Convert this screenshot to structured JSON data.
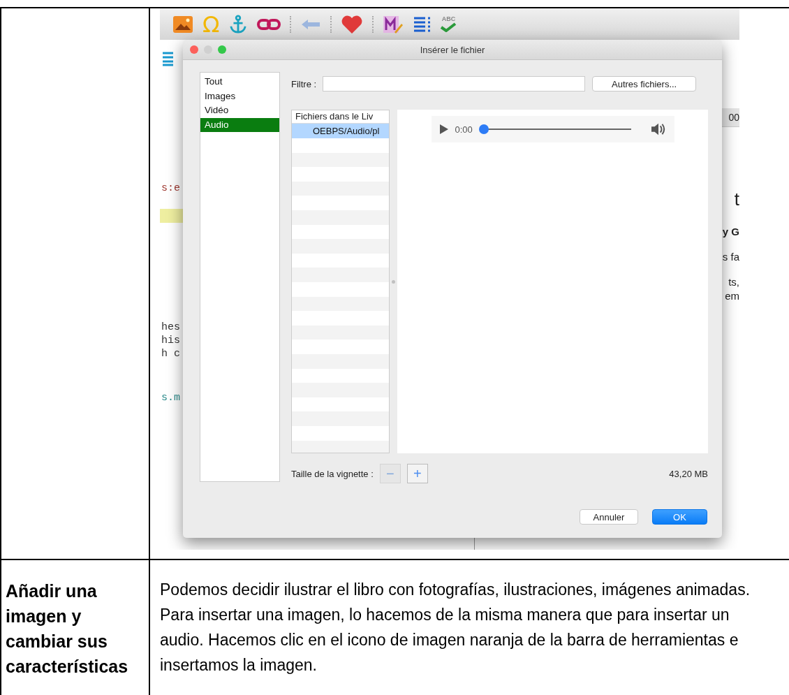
{
  "table": {
    "rows": [
      {
        "heading": "",
        "screenshot": {
          "toolbar": {
            "omega_glyph": "Ω",
            "spellcheck_label": "ABC"
          },
          "editor_fragments": [
            {
              "text": "s:e",
              "color": "#a03a32"
            },
            {
              "text": "hes",
              "color": "#333333"
            },
            {
              "text": "his",
              "color": "#333333"
            },
            {
              "text": "h c",
              "color": "#333333"
            },
            {
              "text": "s.m",
              "color": "#2a8a8a"
            }
          ],
          "preview_header": "00",
          "preview_fragments": [
            {
              "text": "t",
              "kind": "title"
            },
            {
              "text": "y G",
              "kind": "bold"
            },
            {
              "text": "s fa",
              "kind": "plain"
            },
            {
              "text": "ts,",
              "kind": "plain"
            },
            {
              "text": "em",
              "kind": "plain"
            }
          ],
          "dialog": {
            "title": "Insérer le fichier",
            "categories": [
              {
                "label": "Tout",
                "selected": false
              },
              {
                "label": "Images",
                "selected": false
              },
              {
                "label": "Vidéo",
                "selected": false
              },
              {
                "label": "Audio",
                "selected": true
              }
            ],
            "filter_label": "Filtre :",
            "other_files_button": "Autres fichiers...",
            "files_header": "Fichiers dans le Liv",
            "files": [
              {
                "name": "OEBPS/Audio/pl",
                "selected": true
              }
            ],
            "player": {
              "time": "0:00",
              "level": 0
            },
            "thumbnail_label": "Taille de la vignette :",
            "thumbnail_buttons": [
              {
                "label": "−",
                "disabled": true
              },
              {
                "label": "+",
                "disabled": false
              }
            ],
            "size": "43,20 MB",
            "buttons": [
              {
                "label": "Annuler",
                "kind": "secondary"
              },
              {
                "label": "OK",
                "kind": "primary"
              }
            ]
          }
        }
      },
      {
        "heading": "Añadir una imagen y cambiar sus características",
        "text": "Podemos decidir ilustrar el libro con fotografías, ilustraciones, imágenes animadas. Para insertar una imagen, lo hacemos de la misma manera que para insertar un audio. Hacemos clic en el icono de imagen naranja de la barra de herramientas e insertamos la imagen."
      }
    ]
  }
}
